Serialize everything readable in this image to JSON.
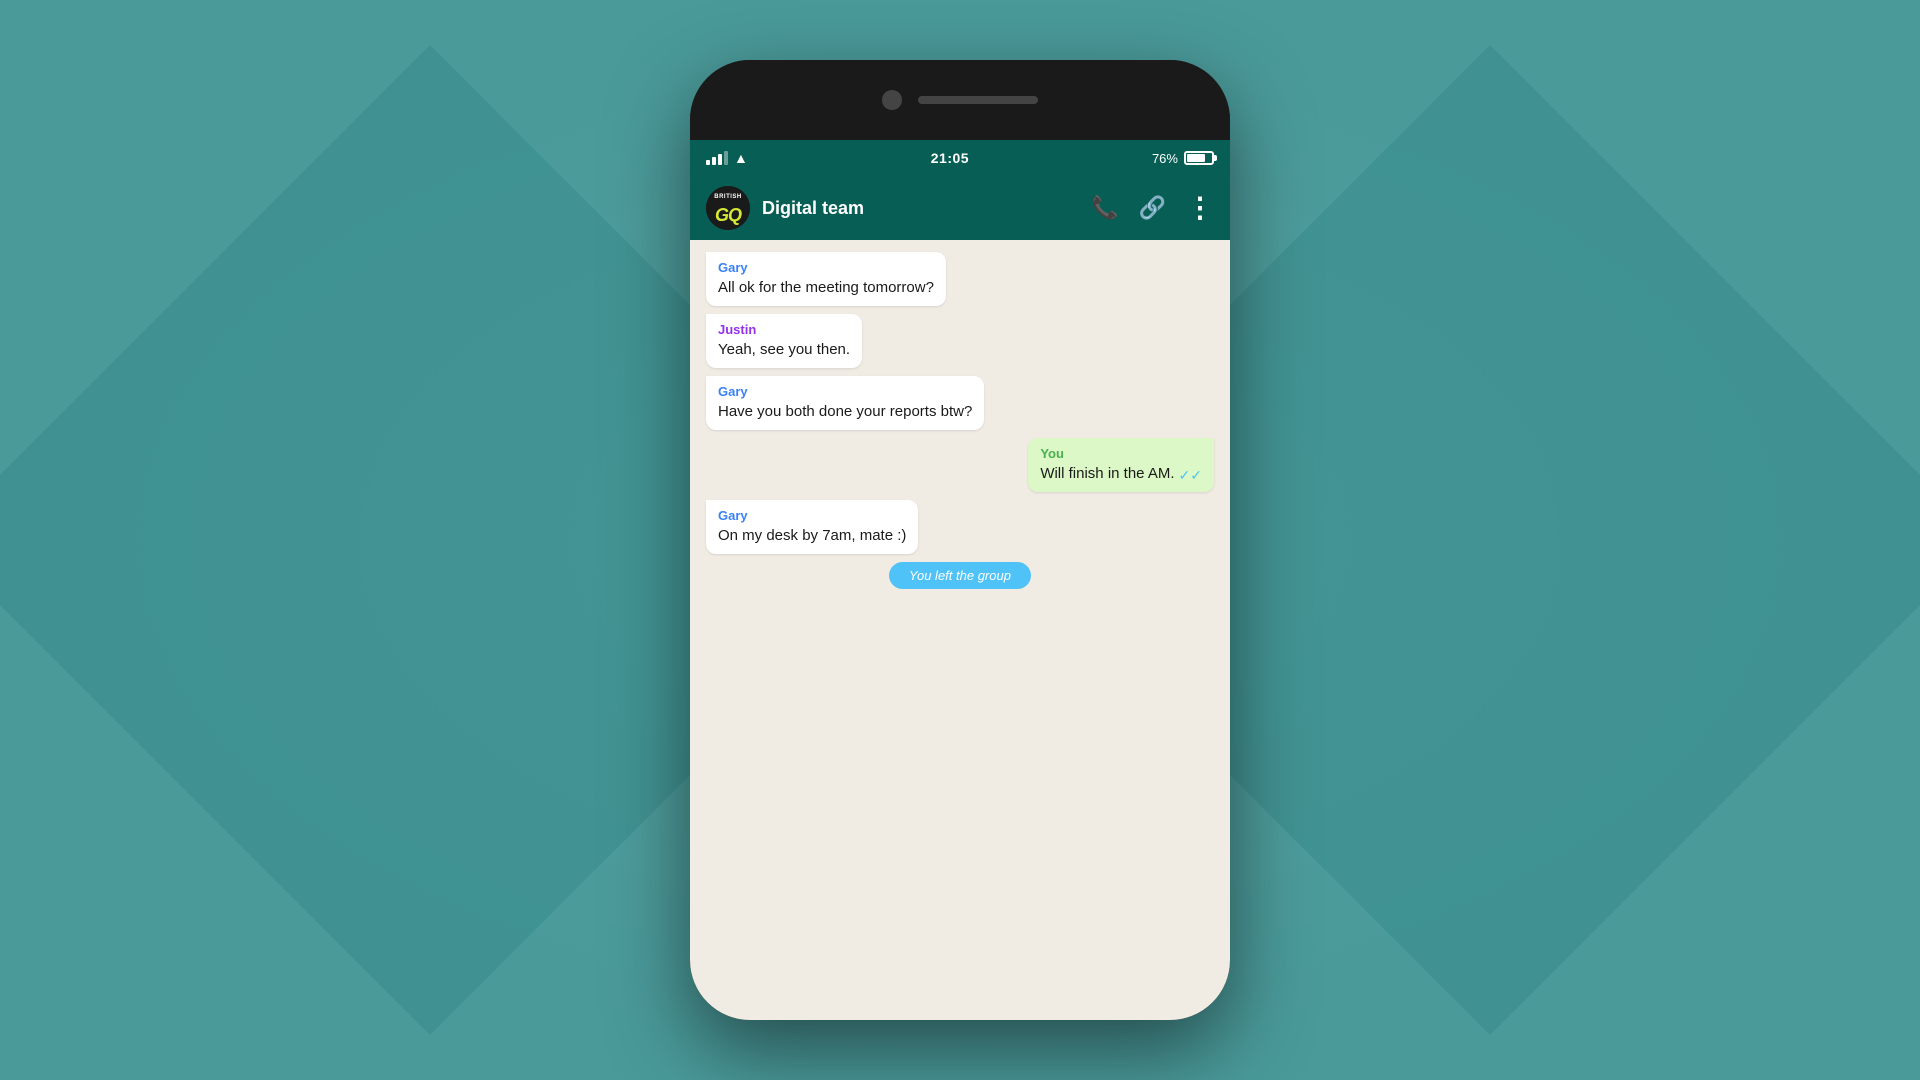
{
  "background": {
    "color": "#4a9a9a"
  },
  "status_bar": {
    "time": "21:05",
    "battery_percent": "76%",
    "signal_label": "signal"
  },
  "chat_header": {
    "group_name": "Digital team",
    "avatar_brand_top": "BRITISH",
    "avatar_brand_main": "GQ"
  },
  "messages": [
    {
      "id": "msg1",
      "type": "incoming",
      "sender": "Gary",
      "sender_color": "gary",
      "text": "All ok for the meeting tomorrow?"
    },
    {
      "id": "msg2",
      "type": "incoming",
      "sender": "Justin",
      "sender_color": "justin",
      "text": "Yeah, see you then."
    },
    {
      "id": "msg3",
      "type": "incoming",
      "sender": "Gary",
      "sender_color": "gary",
      "text": "Have you both done your reports btw?"
    },
    {
      "id": "msg4",
      "type": "outgoing",
      "sender": "You",
      "text": "Will finish in the AM.",
      "read": true
    },
    {
      "id": "msg5",
      "type": "incoming",
      "sender": "Gary",
      "sender_color": "gary",
      "text": "On my desk by 7am, mate :)"
    },
    {
      "id": "msg6",
      "type": "system",
      "text": "You left the group"
    }
  ],
  "icons": {
    "phone": "📞",
    "link": "🔗",
    "more": "⋮",
    "double_tick": "✓✓"
  }
}
